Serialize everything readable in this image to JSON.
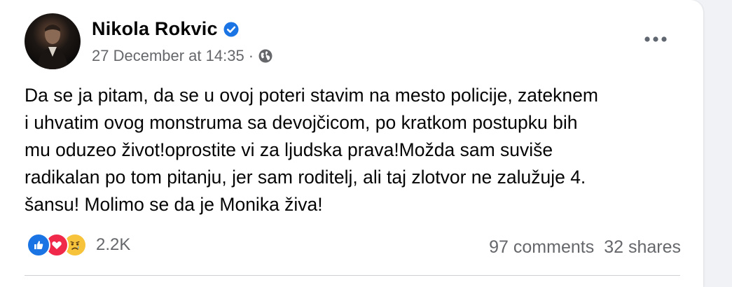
{
  "post": {
    "author": "Nikola Rokvic",
    "timestamp": "27 December at 14:35",
    "separator": "·",
    "audience_icon": "globe-icon",
    "verified_icon": "verified-badge-icon",
    "more_icon": "more-options-icon",
    "text": "Da se ja pitam, da se u ovoj poteri stavim na mesto policije, zateknem\ni uhvatim ovog monstruma sa devojčicom, po kratkom postupku bih\nmu oduzeo život!oprostite vi za ljudska prava!Možda sam suviše\nradikalan po tom pitanju, jer sam roditelj, ali taj zlotvor ne zalužuje 4.\nšansu! Molimo se da je Monika živa!"
  },
  "reactions": {
    "types": [
      "like-icon",
      "love-icon",
      "sad-icon"
    ],
    "count": "2.2K"
  },
  "engagement": {
    "comments": "97 comments",
    "shares": "32 shares"
  },
  "colors": {
    "like": "#1b74e4",
    "love": "#f0284a",
    "sad": "#f7c33a",
    "secondary_text": "#65676b",
    "verified": "#1b74e4"
  }
}
